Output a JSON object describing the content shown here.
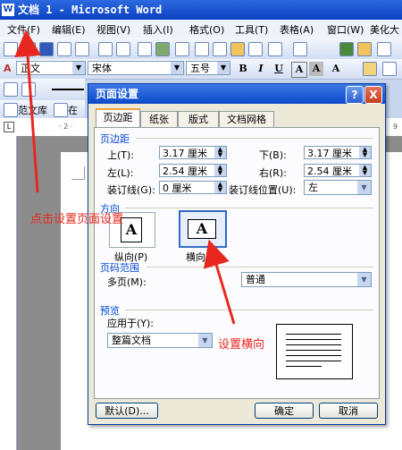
{
  "window": {
    "title": "文档 1 - Microsoft Word",
    "icon": "word-document-icon"
  },
  "menu": [
    "文件(F)",
    "编辑(E)",
    "视图(V)",
    "插入(I)",
    "格式(O)",
    "工具(T)",
    "表格(A)",
    "窗口(W)",
    "美化大"
  ],
  "format_toolbar": {
    "style": "正文",
    "font": "宋体",
    "size": "五号",
    "bold": "B",
    "italic": "I",
    "underline": "U",
    "font_color": "A"
  },
  "toolbar3": {
    "label": "范文库",
    "label2": "在线"
  },
  "ruler": {
    "marks": "· 2 ·",
    "right_mark": "9"
  },
  "dialog": {
    "title": "页面设置",
    "help": "?",
    "close": "X",
    "tabs": [
      "页边距",
      "纸张",
      "版式",
      "文档网格"
    ],
    "margins": {
      "group": "页边距",
      "top_label": "上(T):",
      "top_value": "3.17 厘米",
      "bottom_label": "下(B):",
      "bottom_value": "3.17 厘米",
      "left_label": "左(L):",
      "left_value": "2.54 厘米",
      "right_label": "右(R):",
      "right_value": "2.54 厘米",
      "gutter_label": "装订线(G):",
      "gutter_value": "0 厘米",
      "gutter_pos_label": "装订线位置(U):",
      "gutter_pos_value": "左"
    },
    "orientation": {
      "group": "方向",
      "portrait": "纵向(P)",
      "landscape": "横向(S)",
      "selected": "landscape"
    },
    "pages": {
      "group": "页码范围",
      "label": "多页(M):",
      "value": "普通"
    },
    "preview": {
      "group": "预览",
      "apply_label": "应用于(Y):",
      "apply_value": "整篇文档"
    },
    "buttons": {
      "default": "默认(D)...",
      "ok": "确定",
      "cancel": "取消"
    }
  },
  "annotations": {
    "page_setup_note": "点击设置页面设置",
    "landscape_note": "设置横向"
  },
  "colors": {
    "annotation": "#e8281f",
    "title_bar": "#0a3fc2"
  }
}
